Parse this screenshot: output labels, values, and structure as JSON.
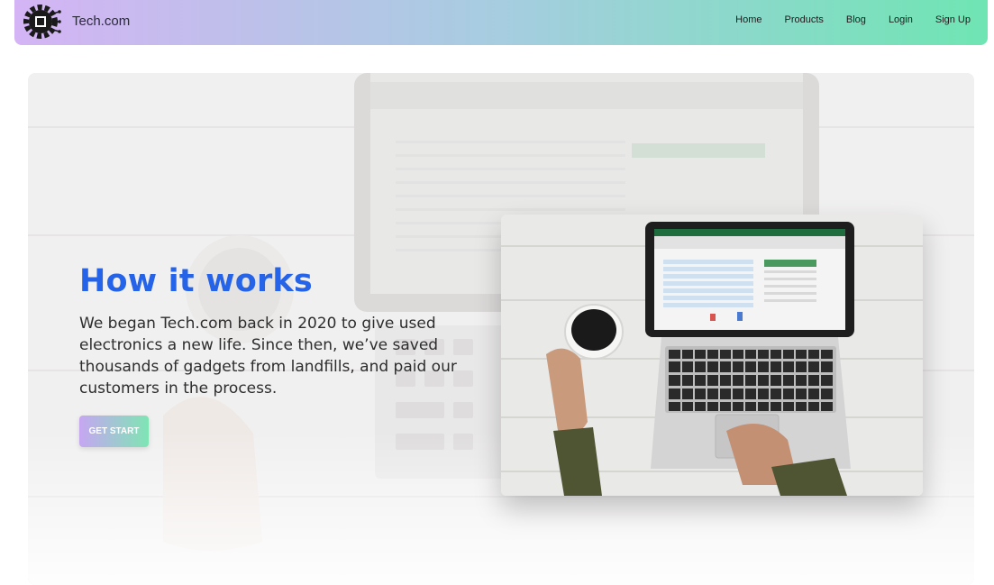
{
  "nav": {
    "brand": "Tech.com",
    "logo_icon": "chip-gear-icon",
    "links": [
      "Home",
      "Products",
      "Blog",
      "Login",
      "Sign Up"
    ]
  },
  "hero": {
    "title": "How it works",
    "description": "We began Tech.com back in 2020 to give used electronics a new life. Since then, we’ve saved thousands of gadgets from landfills, and paid our customers in the process.",
    "cta_label": "GET START"
  },
  "colors": {
    "nav_gradient_start": "#d4b4f4",
    "nav_gradient_end": "#6fe5b3",
    "heading": "#2563e8",
    "cta_gradient_start": "#c6a6f2",
    "cta_gradient_end": "#7ee5b4"
  }
}
